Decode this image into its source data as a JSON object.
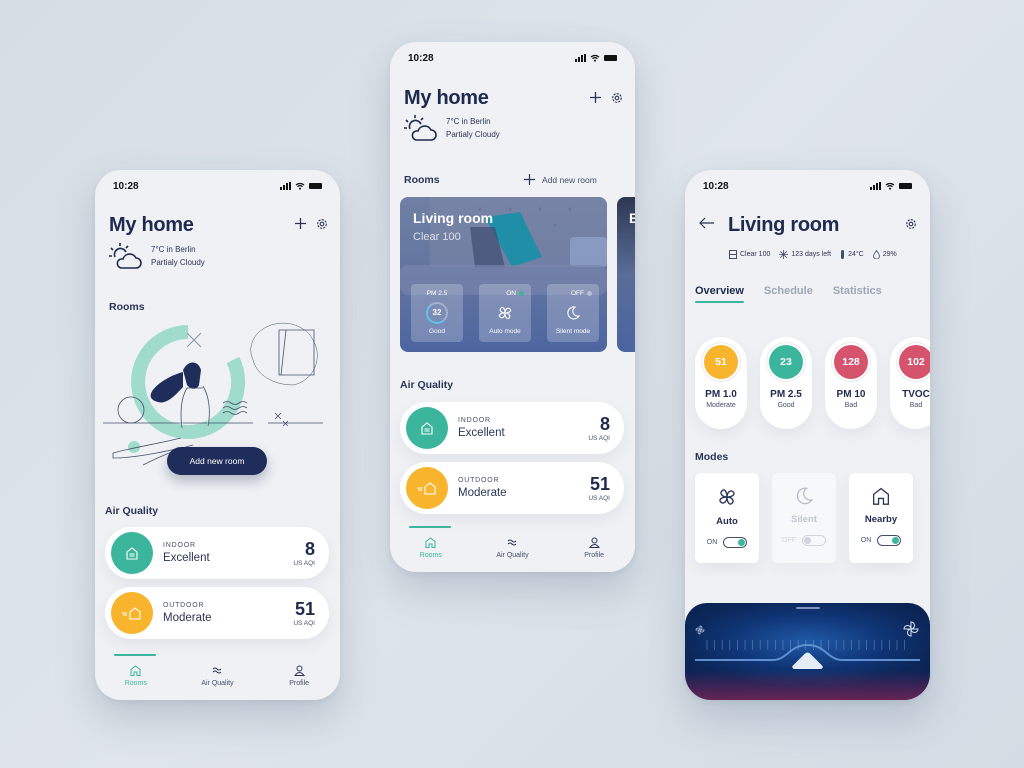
{
  "status_time": "10:28",
  "phone1": {
    "title": "My home",
    "weather": {
      "line1": "7°C in Berlin",
      "line2": "Partialy Cloudy"
    },
    "rooms_label": "Rooms",
    "add_room_button": "Add new room",
    "air_quality_label": "Air Quality",
    "air_quality": [
      {
        "label": "INDOOR",
        "status": "Excellent",
        "value": "8",
        "unit": "US AQI",
        "color": "#3bb59c"
      },
      {
        "label": "OUTDOOR",
        "status": "Moderate",
        "value": "51",
        "unit": "US AQI",
        "color": "#f7b42c"
      }
    ],
    "nav": [
      {
        "label": "Rooms",
        "active": true
      },
      {
        "label": "Air Quality"
      },
      {
        "label": "Profile"
      }
    ]
  },
  "phone2": {
    "title": "My home",
    "weather": {
      "line1": "7°C in Berlin",
      "line2": "Partialy Cloudy"
    },
    "rooms_label": "Rooms",
    "add_room_link": "Add new room",
    "room_card": {
      "name": "Living room",
      "subtitle": "Clear 100",
      "tiles": [
        {
          "top": "PM 2.5",
          "value": "32",
          "bottom": "Good"
        },
        {
          "top": "ON",
          "bottom": "Auto mode",
          "status_color": "#3bb59c"
        },
        {
          "top": "OFF",
          "bottom": "Silent mode",
          "status_color": "#c9d0dd"
        }
      ]
    },
    "next_room_initial": "B",
    "air_quality_label": "Air Quality",
    "air_quality": [
      {
        "label": "INDOOR",
        "status": "Excellent",
        "value": "8",
        "unit": "US AQI",
        "color": "#3bb59c"
      },
      {
        "label": "OUTDOOR",
        "status": "Moderate",
        "value": "51",
        "unit": "US AQI",
        "color": "#f7b42c"
      }
    ],
    "nav": [
      {
        "label": "Rooms",
        "active": true
      },
      {
        "label": "Air Quality"
      },
      {
        "label": "Profile"
      }
    ]
  },
  "phone3": {
    "title": "Living room",
    "info": {
      "filter": "Clear 100",
      "days_left": "123 days left",
      "temperature": "24°C",
      "humidity": "29%"
    },
    "tabs": [
      {
        "label": "Overview",
        "active": true
      },
      {
        "label": "Schedule"
      },
      {
        "label": "Statistics"
      }
    ],
    "metrics": [
      {
        "value": "51",
        "name": "PM 1.0",
        "status": "Moderate",
        "color": "#f7b42c"
      },
      {
        "value": "23",
        "name": "PM 2.5",
        "status": "Good",
        "color": "#3bb59c"
      },
      {
        "value": "128",
        "name": "PM 10",
        "status": "Bad",
        "color": "#d6536d"
      },
      {
        "value": "102",
        "name": "TVOC",
        "status": "Bad",
        "color": "#d6536d"
      }
    ],
    "modes_label": "Modes",
    "modes": [
      {
        "name": "Auto",
        "state": "ON"
      },
      {
        "name": "Silent",
        "state": "OFF"
      },
      {
        "name": "Nearby",
        "state": "ON"
      }
    ],
    "fan_speed": 0.5
  }
}
